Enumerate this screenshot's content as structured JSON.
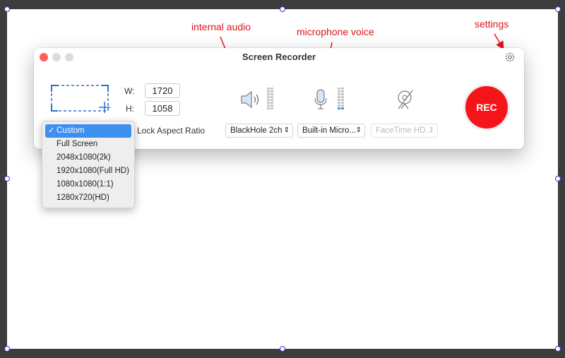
{
  "annotations": {
    "internal_audio": "internal audio",
    "microphone_voice": "microphone voice",
    "settings": "settings"
  },
  "window": {
    "title": "Screen Recorder"
  },
  "size": {
    "w_label": "W:",
    "w_value": "1720",
    "h_label": "H:",
    "h_value": "1058"
  },
  "lock_aspect_label": "Lock Aspect Ratio",
  "audio_select": "BlackHole 2ch",
  "mic_select": "Built-in Micro...",
  "camera_select": "FaceTime HD...",
  "rec_label": "REC",
  "preset_menu": {
    "items": [
      "Custom",
      "Full Screen",
      "2048x1080(2k)",
      "1920x1080(Full HD)",
      "1080x1080(1:1)",
      "1280x720(HD)"
    ],
    "selected": "Custom",
    "check": "✓"
  },
  "colors": {
    "accent": "#3d8ff0",
    "rec": "#f5141a",
    "annotation": "#e0141c"
  }
}
